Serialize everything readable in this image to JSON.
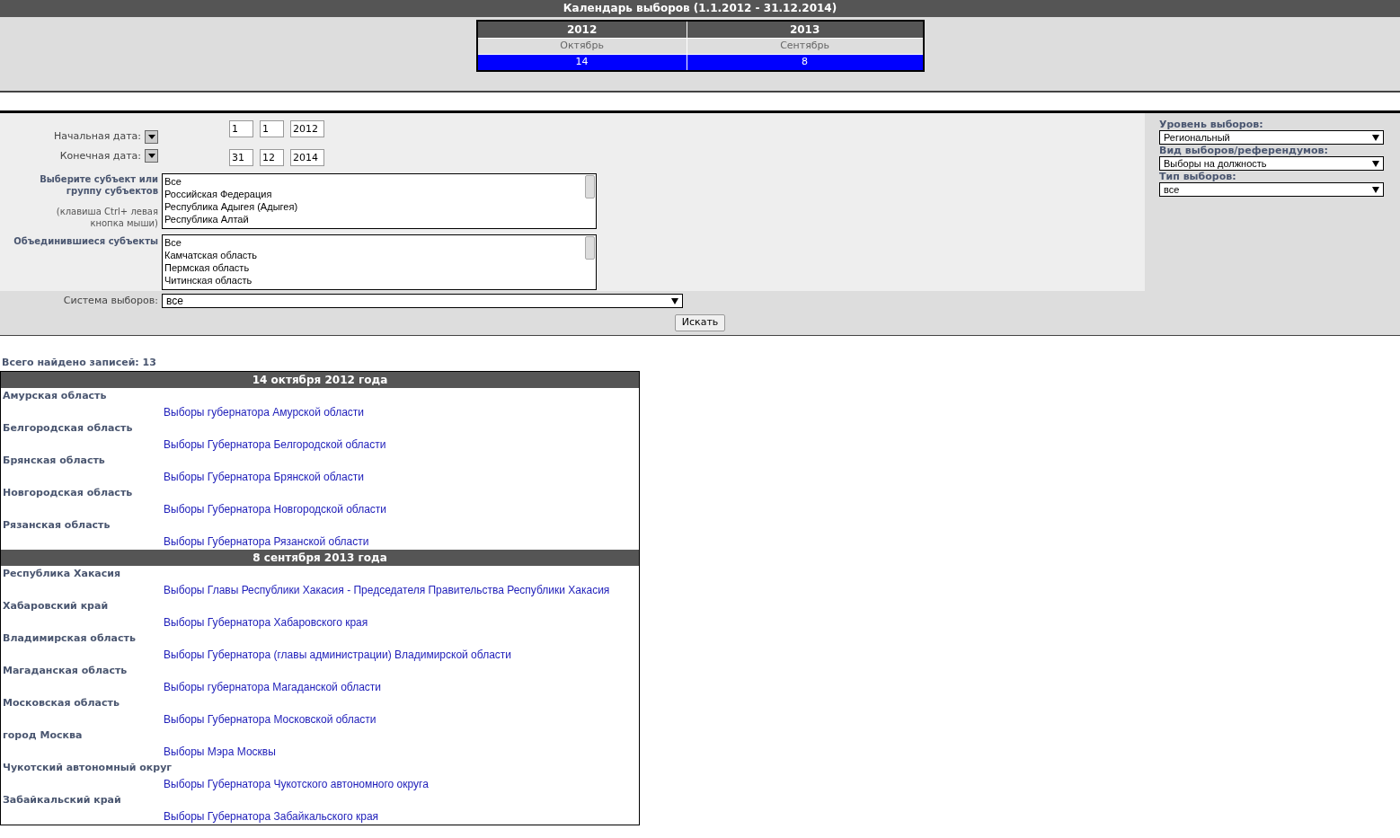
{
  "calendar": {
    "title": "Календарь выборов (1.1.2012 - 31.12.2014)",
    "columns": [
      {
        "year": "2012",
        "month": "Октябрь",
        "day": "14"
      },
      {
        "year": "2013",
        "month": "Сентябрь",
        "day": "8"
      }
    ]
  },
  "filters": {
    "start_date": {
      "label": "Начальная дата:",
      "values": [
        "1",
        "1",
        "2012"
      ]
    },
    "end_date": {
      "label": "Конечная дата:",
      "values": [
        "31",
        "12",
        "2014"
      ]
    },
    "subjects": {
      "label": "Выберите субъект или группу субъектов",
      "hint": "(клавиша Ctrl+ левая кнопка мыши)",
      "options": [
        "Все",
        "Российская Федерация",
        "Республика Адыгея (Адыгея)",
        "Республика Алтай"
      ]
    },
    "merged_subjects": {
      "label": "Объединившиеся субъекты",
      "options": [
        "Все",
        "Камчатская область",
        "Пермская область",
        "Читинская область"
      ]
    },
    "system": {
      "label": "Система выборов:",
      "value": "все"
    },
    "search_button": "Искать",
    "side_selects": [
      {
        "label": "Уровень выборов:",
        "value": "Региональный"
      },
      {
        "label": "Вид выборов/референдумов:",
        "value": "Выборы на должность"
      },
      {
        "label": "Тип выборов:",
        "value": "все"
      }
    ]
  },
  "results": {
    "count": "Всего найдено записей: 13",
    "groups": [
      {
        "date": "14 октября 2012 года",
        "entries": [
          {
            "region": "Амурская область",
            "election": "Выборы губернатора Амурской области"
          },
          {
            "region": "Белгородская область",
            "election": "Выборы Губернатора Белгородской области"
          },
          {
            "region": "Брянская область",
            "election": "Выборы Губернатора Брянской области"
          },
          {
            "region": "Новгородская область",
            "election": "Выборы Губернатора Новгородской области"
          },
          {
            "region": "Рязанская область",
            "election": "Выборы Губернатора Рязанской области"
          }
        ]
      },
      {
        "date": "8 сентября 2013 года",
        "entries": [
          {
            "region": "Республика Хакасия",
            "election": "Выборы Главы Республики Хакасия - Председателя Правительства Республики Хакасия"
          },
          {
            "region": "Хабаровский край",
            "election": "Выборы Губернатора Хабаровского края"
          },
          {
            "region": "Владимирская область",
            "election": "Выборы Губернатора (главы администрации) Владимирской области"
          },
          {
            "region": "Магаданская область",
            "election": "Выборы губернатора Магаданской области"
          },
          {
            "region": "Московская область",
            "election": "Выборы Губернатора Московской области"
          },
          {
            "region": "город Москва",
            "election": "Выборы Мэра Москвы"
          },
          {
            "region": "Чукотский автономный округ",
            "election": "Выборы Губернатора Чукотского автономного округа"
          },
          {
            "region": "Забайкальский край",
            "election": "Выборы Губернатора Забайкальского края"
          }
        ]
      }
    ]
  }
}
